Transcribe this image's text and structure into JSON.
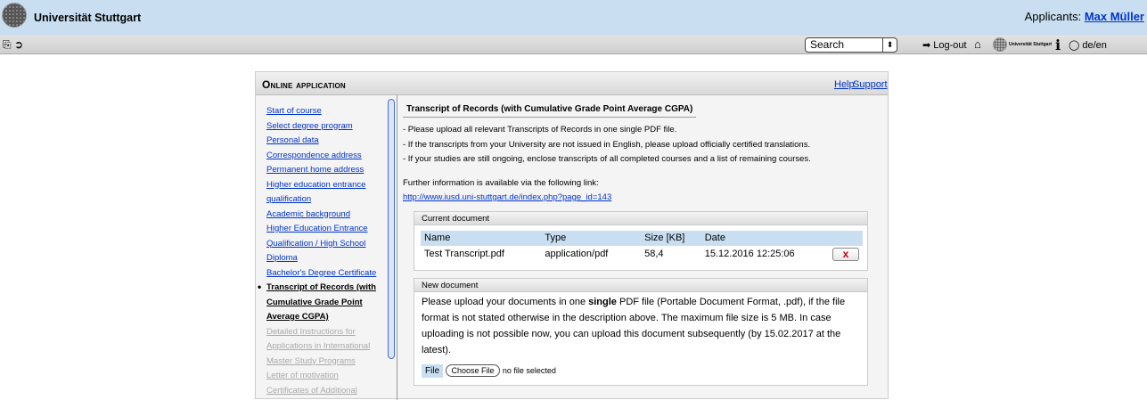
{
  "header": {
    "university": "Universität Stuttgart",
    "applicant_label": "Applicants:",
    "applicant_name": "Max Müller"
  },
  "toolbar": {
    "search_select": "Search",
    "logout": "Log-out",
    "small_logo_text": "Universität Stuttgart",
    "lang": "de/en"
  },
  "panel": {
    "title": "Online application",
    "help": "Help",
    "support": "Support"
  },
  "nav": {
    "items": [
      {
        "label": "Start of course",
        "state": "link"
      },
      {
        "label": "Select degree program",
        "state": "link"
      },
      {
        "label": "Personal data",
        "state": "link"
      },
      {
        "label": "Correspondence address",
        "state": "link"
      },
      {
        "label": "Permanent home address",
        "state": "link"
      },
      {
        "label": "Higher education entrance",
        "state": "link"
      },
      {
        "label": "qualification",
        "state": "link"
      },
      {
        "label": "Academic background",
        "state": "link"
      },
      {
        "label": "Higher Education Entrance",
        "state": "link"
      },
      {
        "label": "Qualification / High School",
        "state": "link"
      },
      {
        "label": "Diploma",
        "state": "link"
      },
      {
        "label": "Bachelor's Degree Certificate",
        "state": "link"
      },
      {
        "label": "Transcript of Records (with",
        "state": "active"
      },
      {
        "label": "Cumulative Grade Point",
        "state": "active"
      },
      {
        "label": "Average CGPA)",
        "state": "active"
      },
      {
        "label": "Detailed Instructions for",
        "state": "disabled"
      },
      {
        "label": "Applications in International",
        "state": "disabled"
      },
      {
        "label": "Master Study Programs",
        "state": "disabled"
      },
      {
        "label": "Letter of motivation",
        "state": "disabled"
      },
      {
        "label": "Certificates of Additional",
        "state": "disabled"
      }
    ]
  },
  "content": {
    "section_title": "Transcript of Records (with Cumulative Grade Point Average CGPA)",
    "instructions": [
      "- Please upload all relevant Transcripts of Records in one single PDF file.",
      "- If the transcripts from your University are not issued in English, please upload officially certified translations.",
      "- If your studies are still ongoing, enclose transcripts of all completed courses and a list of remaining courses."
    ],
    "further_info": "Further information is available via the following link:",
    "link": "http://www.iusd.uni-stuttgart.de/index.php?page_id=143",
    "current_document": {
      "heading": "Current document",
      "columns": [
        "Name",
        "Type",
        "Size [KB]",
        "Date"
      ],
      "row": {
        "name": "Test Transcript.pdf",
        "type": "application/pdf",
        "size": "58,4",
        "date": "15.12.2016 12:25:06",
        "delete": "x"
      }
    },
    "new_document": {
      "heading": "New document",
      "text_before": "Please upload your documents in one ",
      "text_bold": "single",
      "text_after": " PDF file (Portable Document Format, .pdf), if the file format is not stated otherwise in the description above. The maximum file size is 5 MB. In case uploading is not possible now, you can upload this document subsequently (by 15.02.2017 at the latest).",
      "file_label": "File",
      "choose_button": "Choose File",
      "no_file": "no file selected"
    }
  },
  "colors": {
    "header_bg": "#c9dff1",
    "link": "#0033cc",
    "delete": "#cc0000"
  }
}
